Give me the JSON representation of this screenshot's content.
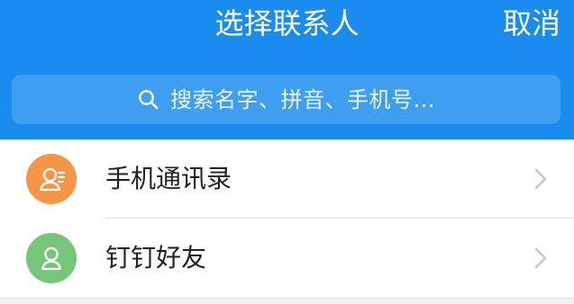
{
  "colors": {
    "brand": "#1a8cf0",
    "contacts_avatar": "#f59547",
    "friends_avatar": "#76c677"
  },
  "header": {
    "title": "选择联系人",
    "cancel_label": "取消"
  },
  "search": {
    "placeholder": "搜索名字、拼音、手机号...",
    "icon": "search-icon"
  },
  "contacts": {
    "items": [
      {
        "label": "手机通讯录",
        "icon": "phonebook-contact-icon"
      },
      {
        "label": "钉钉好友",
        "icon": "friend-person-icon"
      }
    ]
  }
}
